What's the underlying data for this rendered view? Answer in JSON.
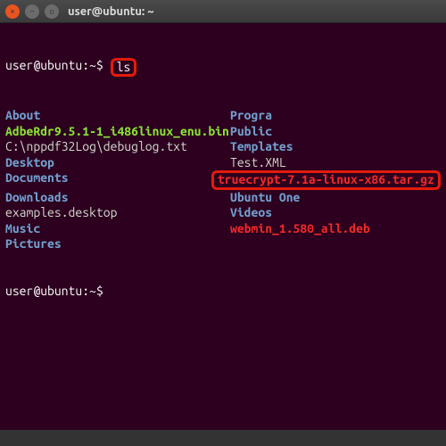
{
  "titlebar": {
    "title": "user@ubuntu: ~"
  },
  "prompt": {
    "user_host": "user@ubuntu",
    "path": "~",
    "sep": ":",
    "dollar": "$"
  },
  "command": "ls",
  "listing": {
    "col1": [
      {
        "text": "About",
        "cls": "blue"
      },
      {
        "text": "AdbeRdr9.5.1-1_i486linux_enu.bin",
        "cls": "green"
      },
      {
        "text": "C:\\nppdf32Log\\debuglog.txt",
        "cls": "white"
      },
      {
        "text": "Desktop",
        "cls": "blue"
      },
      {
        "text": "Documents",
        "cls": "blue"
      },
      {
        "text": "Downloads",
        "cls": "blue"
      },
      {
        "text": "examples.desktop",
        "cls": "white"
      },
      {
        "text": "Music",
        "cls": "blue"
      },
      {
        "text": "Pictures",
        "cls": "blue"
      }
    ],
    "col2": [
      {
        "text": "Progra",
        "cls": "blue"
      },
      {
        "text": "Public",
        "cls": "blue"
      },
      {
        "text": "Templates",
        "cls": "blue"
      },
      {
        "text": "Test.XML",
        "cls": "white"
      },
      {
        "text": "truecrypt-7.1a-linux-x86.tar.gz",
        "cls": "red",
        "hl": true
      },
      {
        "text": "Ubuntu One",
        "cls": "blue"
      },
      {
        "text": "Videos",
        "cls": "blue"
      },
      {
        "text": "webmin_1.580_all.deb",
        "cls": "red"
      }
    ]
  }
}
